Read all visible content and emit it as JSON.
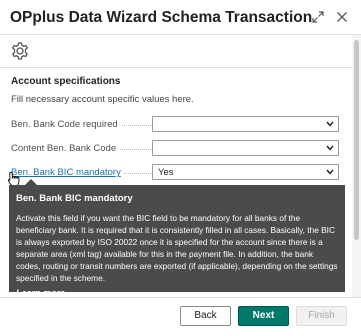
{
  "dialog": {
    "title": "OPplus Data Wizard Schema Transaction"
  },
  "section": {
    "title": "Account specifications",
    "subtitle": "Fill necessary account specific values here."
  },
  "fields": [
    {
      "label": "Ben. Bank Code required",
      "value": ""
    },
    {
      "label": "Content Ben. Bank Code",
      "value": ""
    },
    {
      "label": "Ben. Bank BIC mandatory",
      "value": "Yes"
    }
  ],
  "tooltip": {
    "title": "Ben. Bank BIC mandatory",
    "body": "Activate this field if you want the BIC field to be mandatory for all banks of the beneficiary bank. It is required that it is consistently filled in all cases. Basically, the BIC is always exported by ISO 20022 once it is specified for the account since there is a separate area (xml tag) available for this in the payment file. In addition, the bank codes, routing or transit numbers are exported (if applicable), depending on the settings specified in the scheme.",
    "link": "Learn more"
  },
  "buttons": {
    "back": "Back",
    "next": "Next",
    "finish": "Finish"
  },
  "icons": {
    "expand": "expand-icon",
    "close": "close-icon",
    "settings": "gear-icon",
    "dropdown": "chevron-down-icon"
  },
  "colors": {
    "primary_button": "#00796b",
    "tooltip_bg": "#4b4b4b",
    "link_hover": "#1e6fa7"
  }
}
